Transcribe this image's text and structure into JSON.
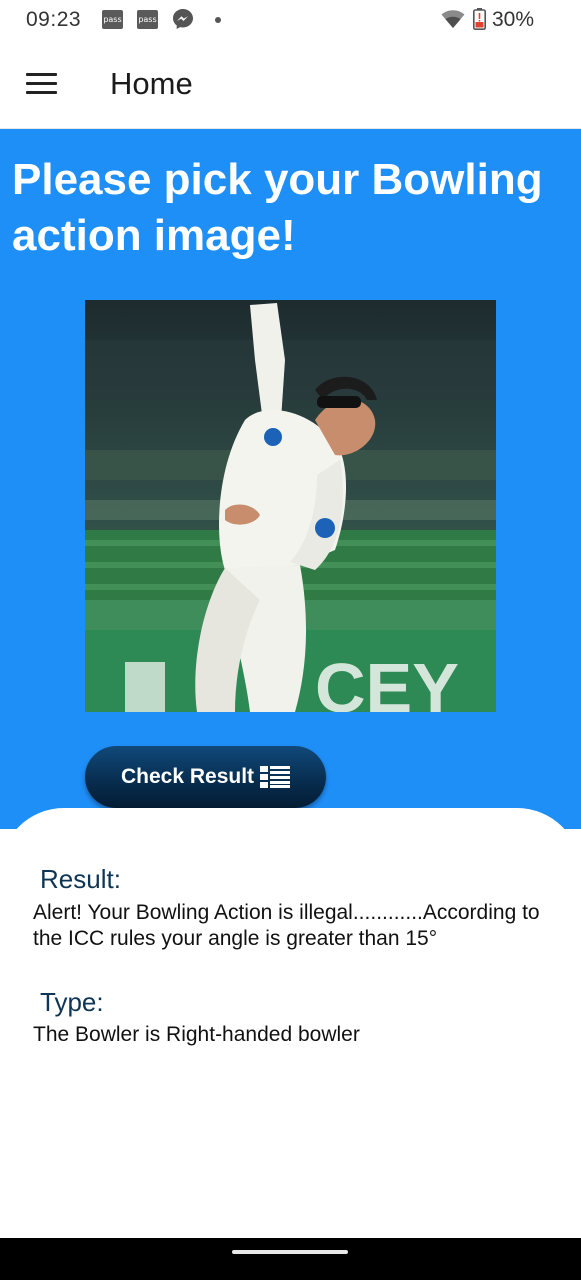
{
  "status_bar": {
    "time": "09:23",
    "notification_icons": [
      "pass",
      "pass"
    ],
    "battery": "30%"
  },
  "app_bar": {
    "title": "Home"
  },
  "page": {
    "headline": "Please pick your Bowling action image!",
    "check_button_label": "Check Result",
    "result_heading": "Result:",
    "result_text": "Alert! Your Bowling Action is illegal............According to the ICC rules your angle is greater than 15°",
    "type_heading": "Type:",
    "type_text": "The Bowler is Right-handed bowler"
  },
  "colors": {
    "primary_blue": "#1f8ff8",
    "button_dark_blue": "#072c4d",
    "heading_text": "#0f3555"
  }
}
